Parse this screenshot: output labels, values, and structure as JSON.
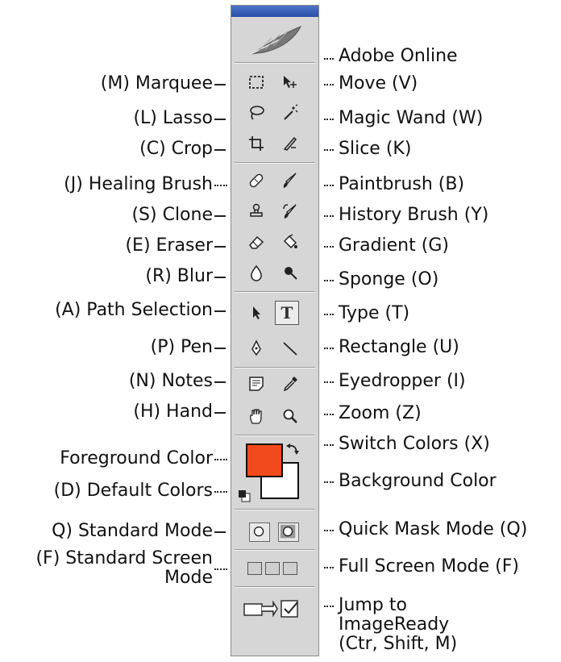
{
  "left_labels": [
    "(M) Marquee",
    "(L) Lasso",
    "(C) Crop",
    "(J) Healing Brush",
    "(S) Clone",
    "(E) Eraser",
    "(R) Blur",
    "(A) Path Selection",
    "(P) Pen",
    "(N) Notes",
    "(H) Hand",
    "Foreground Color",
    "(D) Default Colors",
    "Q) Standard Mode",
    "(F) Standard Screen",
    "Mode"
  ],
  "right_labels": [
    "Adobe Online",
    "Move (V)",
    "Magic Wand (W)",
    "Slice (K)",
    "Paintbrush (B)",
    "History Brush (Y)",
    "Gradient (G)",
    "Sponge (O)",
    "Type (T)",
    "Rectangle (U)",
    "Eyedropper (I)",
    "Zoom (Z)",
    "Switch Colors (X)",
    "Background Color",
    "Quick Mask Mode (Q)",
    "Full Screen Mode (F)",
    "Jump to",
    "ImageReady",
    "(Ctr, Shift, M)"
  ],
  "type_tool_glyph": "T",
  "colors": {
    "foreground": "#f24a1c",
    "background": "#ffffff",
    "titlebar": "#2f55b0",
    "panel": "#d6d6d6"
  },
  "icons": [
    "feather-icon",
    "marquee-icon",
    "move-icon",
    "lasso-icon",
    "magic-wand-icon",
    "crop-icon",
    "slice-icon",
    "healing-brush-icon",
    "paintbrush-icon",
    "clone-stamp-icon",
    "history-brush-icon",
    "eraser-icon",
    "gradient-icon",
    "blur-icon",
    "sponge-icon",
    "path-selection-icon",
    "type-icon",
    "pen-icon",
    "line-icon",
    "notes-icon",
    "eyedropper-icon",
    "hand-icon",
    "zoom-icon"
  ]
}
